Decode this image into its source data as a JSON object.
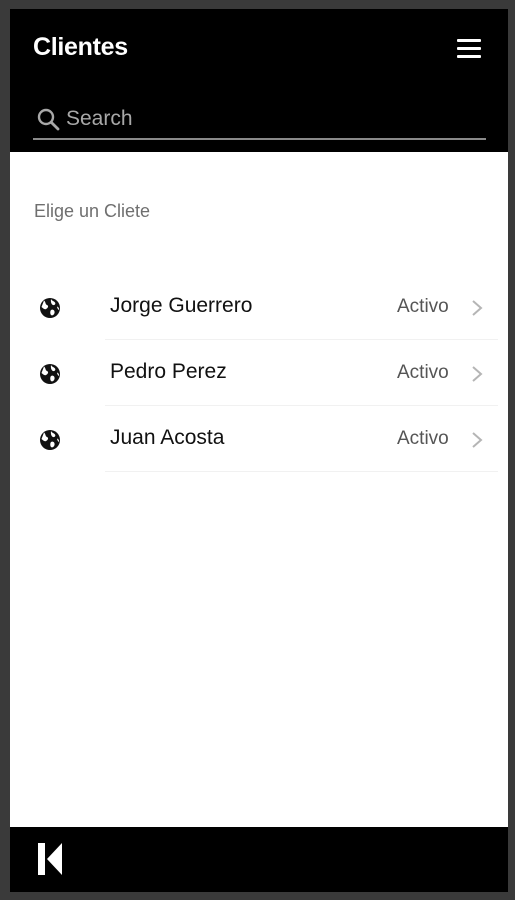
{
  "header": {
    "title": "Clientes",
    "menu_icon": "hamburger-menu-icon"
  },
  "search": {
    "placeholder": "Search",
    "value": "",
    "icon": "search-icon"
  },
  "prompt": "Elige un Cliete",
  "clients": [
    {
      "name": "Jorge Guerrero",
      "status": "Activo",
      "icon": "globe-icon"
    },
    {
      "name": "Pedro Perez",
      "status": "Activo",
      "icon": "globe-icon"
    },
    {
      "name": "Juan Acosta",
      "status": "Activo",
      "icon": "globe-icon"
    }
  ],
  "footer": {
    "logo": "k-logo-icon"
  },
  "colors": {
    "header_bg": "#000000",
    "footer_bg": "#000000",
    "frame_bg": "#3a3a3a",
    "content_bg": "#ffffff"
  }
}
